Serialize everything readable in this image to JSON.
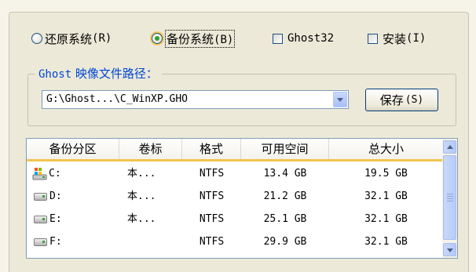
{
  "mode_options": {
    "restore": {
      "label": "还原系统",
      "hotkey": "(R)",
      "selected": false
    },
    "backup": {
      "label": "备份系统",
      "hotkey": "(B)",
      "selected": true
    },
    "ghost32": {
      "label": "Ghost32",
      "checked": false
    },
    "install": {
      "label": "安装",
      "hotkey": "(I)",
      "checked": false
    }
  },
  "path_group": {
    "legend_prefix": "Ghost",
    "legend_text": " 映像文件路径：",
    "combo_value": "G:\\Ghost...\\C_WinXP.GHO",
    "save_button": "保存",
    "save_hotkey": "(S)"
  },
  "partition_table": {
    "columns": [
      "备份分区",
      "卷标",
      "格式",
      "可用空间",
      "总大小"
    ],
    "rows": [
      {
        "drive": "C:",
        "label": "本...",
        "format": "NTFS",
        "free": "13.4 GB",
        "total": "19.5 GB",
        "icon": "system-drive-icon"
      },
      {
        "drive": "D:",
        "label": "本...",
        "format": "NTFS",
        "free": "21.2 GB",
        "total": "32.1 GB",
        "icon": "hard-drive-icon"
      },
      {
        "drive": "E:",
        "label": "本...",
        "format": "NTFS",
        "free": "25.1 GB",
        "total": "32.1 GB",
        "icon": "hard-drive-icon"
      },
      {
        "drive": "F:",
        "label": "",
        "format": "NTFS",
        "free": "29.9 GB",
        "total": "32.1 GB",
        "icon": "hard-drive-icon"
      }
    ]
  },
  "colors": {
    "window_bg": "#ece9d8",
    "legend_text": "#0046d5",
    "header_underline": "#f1c64e",
    "radio_dot": "#2f9f2f"
  }
}
